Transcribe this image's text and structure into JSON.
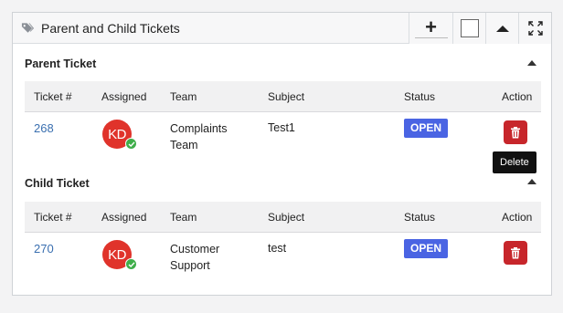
{
  "panel": {
    "title": "Parent and Child Tickets",
    "header_buttons": [
      "plus-icon",
      "checkbox-square",
      "collapse-triangle-icon",
      "expand-icon"
    ]
  },
  "columns": [
    "Ticket #",
    "Assigned",
    "Team",
    "Subject",
    "Status",
    "Action"
  ],
  "parent": {
    "title": "Parent Ticket",
    "rows": [
      {
        "ticket": "268",
        "assigned": "KD",
        "team_line1": "Complaints",
        "team_line2": "Team",
        "subject": "Test1",
        "status": "OPEN"
      }
    ]
  },
  "child": {
    "title": "Child Ticket",
    "rows": [
      {
        "ticket": "270",
        "assigned": "KD",
        "team_line1": "Customer",
        "team_line2": "Support",
        "subject": "test",
        "status": "OPEN"
      }
    ]
  },
  "tooltip": {
    "text": "Delete"
  },
  "colors": {
    "status_open": "#4a64e3",
    "delete_button": "#c7262b",
    "avatar": "#e0332b",
    "online": "#3fae4a",
    "link": "#3a6fb0"
  }
}
